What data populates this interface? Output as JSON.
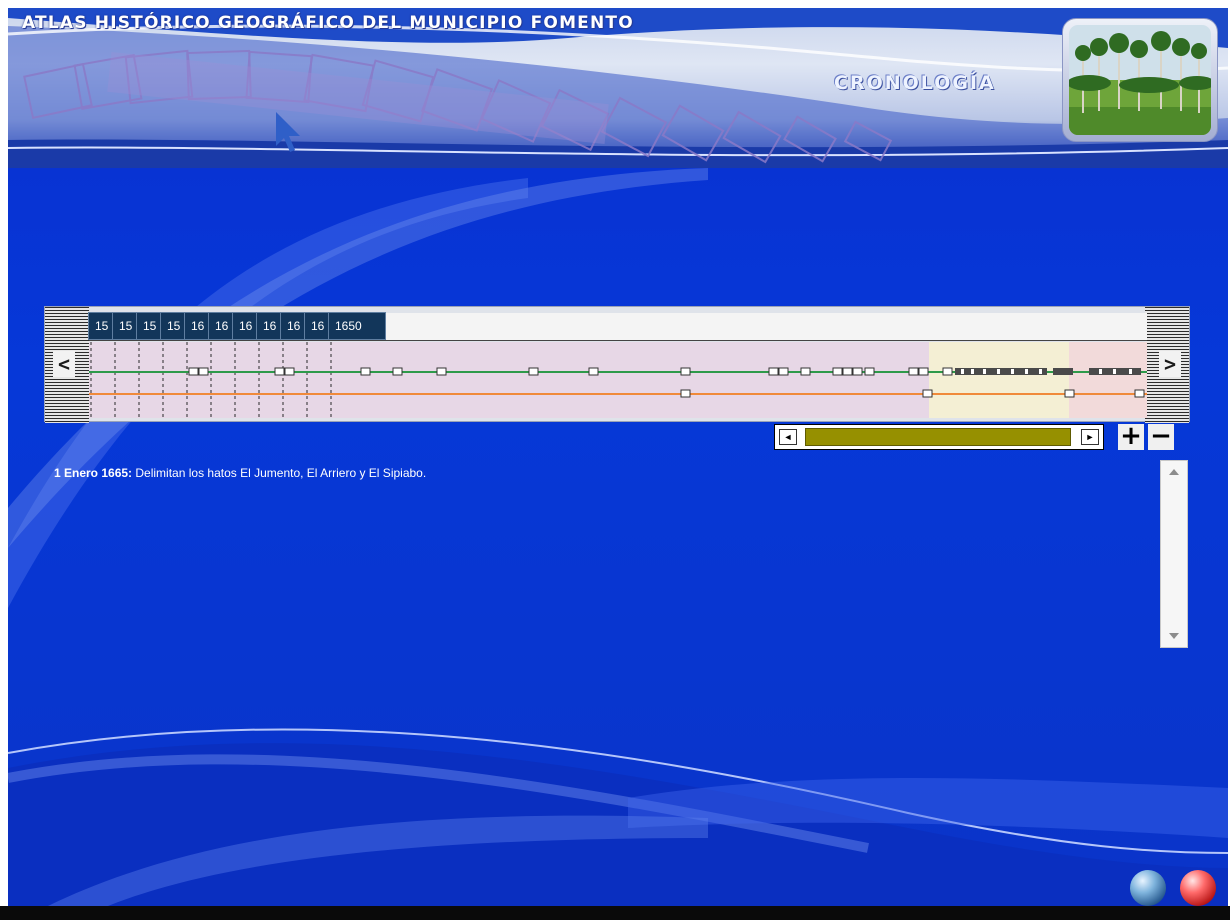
{
  "header": {
    "app_title": "ATLAS HISTÓRICO GEOGRÁFICO DEL MUNICIPIO FOMENTO",
    "section_title": "CRONOLOGÍA"
  },
  "timeline": {
    "nav_prev": "<",
    "nav_next": ">",
    "markers": [
      "15",
      "15",
      "15",
      "15",
      "16",
      "16",
      "16",
      "16",
      "16",
      "16",
      "1650"
    ]
  },
  "scroller": {
    "left_arrow": "◄",
    "right_arrow": "►",
    "zoom_in": "+",
    "zoom_out": "−"
  },
  "event": {
    "date": "1 Enero 1665:",
    "description": " Delimitan los hatos El Jumento, El Arriero y El Sipiabo."
  },
  "colors": {
    "background": "#0638d8",
    "track_green": "#2e9a4a",
    "track_orange": "#f08a3a",
    "marker": "#12365a",
    "scroll_thumb": "#969000"
  },
  "icons": {
    "orb_blue": "blue-orb-icon",
    "orb_red": "red-orb-icon"
  }
}
